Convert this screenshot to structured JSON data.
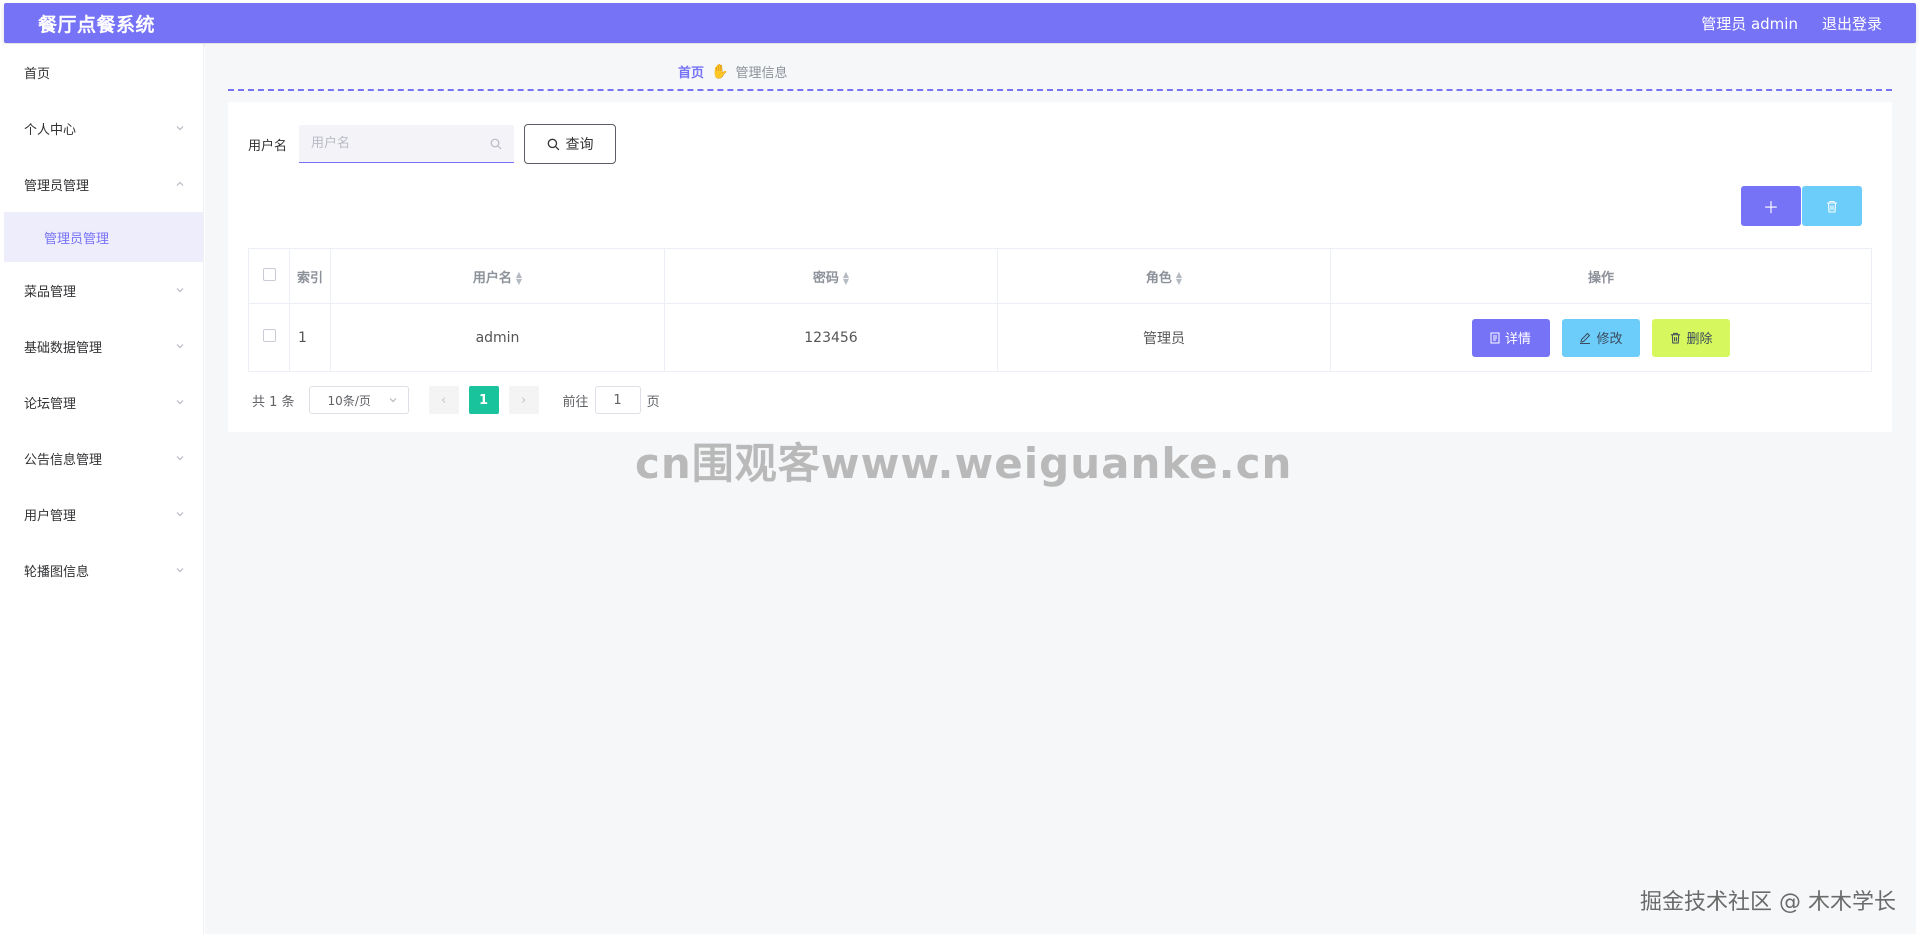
{
  "header": {
    "title": "餐厅点餐系统",
    "user_label": "管理员 admin",
    "logout_label": "退出登录"
  },
  "sidebar": {
    "items": [
      {
        "label": "首页",
        "has_arrow": false
      },
      {
        "label": "个人中心",
        "has_arrow": true
      },
      {
        "label": "管理员管理",
        "has_arrow": true,
        "expanded": true
      },
      {
        "label": "菜品管理",
        "has_arrow": true
      },
      {
        "label": "基础数据管理",
        "has_arrow": true
      },
      {
        "label": "论坛管理",
        "has_arrow": true
      },
      {
        "label": "公告信息管理",
        "has_arrow": true
      },
      {
        "label": "用户管理",
        "has_arrow": true
      },
      {
        "label": "轮播图信息",
        "has_arrow": true
      }
    ],
    "sub_item": "管理员管理"
  },
  "breadcrumb": {
    "home": "首页",
    "separator_icon": "hand-icon",
    "current": "管理信息"
  },
  "search": {
    "label": "用户名",
    "placeholder": "用户名",
    "value": "",
    "query_label": "查询"
  },
  "toolbar": {
    "add_icon": "plus-icon",
    "delete_icon": "trash-icon"
  },
  "table": {
    "headers": [
      "索引",
      "用户名",
      "密码",
      "角色",
      "操作"
    ],
    "rows": [
      {
        "index": "1",
        "username": "admin",
        "password": "123456",
        "role": "管理员"
      }
    ],
    "actions": {
      "detail": "详情",
      "edit": "修改",
      "delete": "删除"
    }
  },
  "pagination": {
    "total_label": "共 1 条",
    "page_size": "10条/页",
    "current_page": "1",
    "goto_prefix": "前往",
    "goto_value": "1",
    "goto_suffix": "页"
  },
  "watermarks": {
    "center": "cn围观客www.weiguanke.cn",
    "corner": "掘金技术社区 @ 木木学长"
  },
  "colors": {
    "primary": "#7773f7",
    "info": "#6ccdfb",
    "warning": "#d6f75d",
    "page_active": "#19c39b"
  }
}
